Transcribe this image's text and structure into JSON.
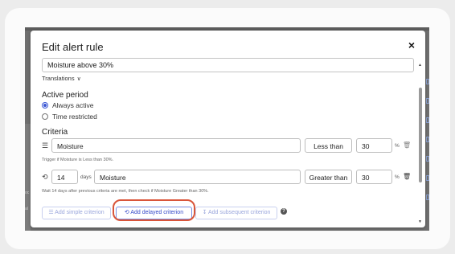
{
  "dialog": {
    "title": "Edit alert rule",
    "close_label": "×",
    "rule_name_value": "Moisture above 30%",
    "translations_label": "Translations",
    "translations_chevron": "∨"
  },
  "active_period": {
    "title": "Active period",
    "options": [
      {
        "label": "Always active",
        "selected": true
      },
      {
        "label": "Time restricted",
        "selected": false
      }
    ]
  },
  "criteria": {
    "title": "Criteria",
    "rows": [
      {
        "icon": "sliders-icon",
        "metric": "Moisture",
        "operator": "Less than",
        "value": "30",
        "unit": "%",
        "hint": "Trigger if Moisture is Less than 30%."
      },
      {
        "icon": "delay-icon",
        "delay_value": "14",
        "delay_unit": "days",
        "metric": "Moisture",
        "operator": "Greater than",
        "value": "30",
        "unit": "%",
        "hint": "Wait 14 days after previous criteria are met, then check if Moisture Greater than 30%."
      }
    ]
  },
  "actions": {
    "add_simple": "☰ Add simple criterion",
    "add_delayed": "⟲ Add delayed criterion",
    "add_subsequent": "↧ Add subsequent criterion",
    "help": "?"
  },
  "colors": {
    "accent": "#3a56d4",
    "highlight_ring": "#d9553a",
    "backdrop": "#6f6f6f"
  },
  "background_fragments": {
    "left_top": "oc",
    "left_bottom": "al"
  }
}
